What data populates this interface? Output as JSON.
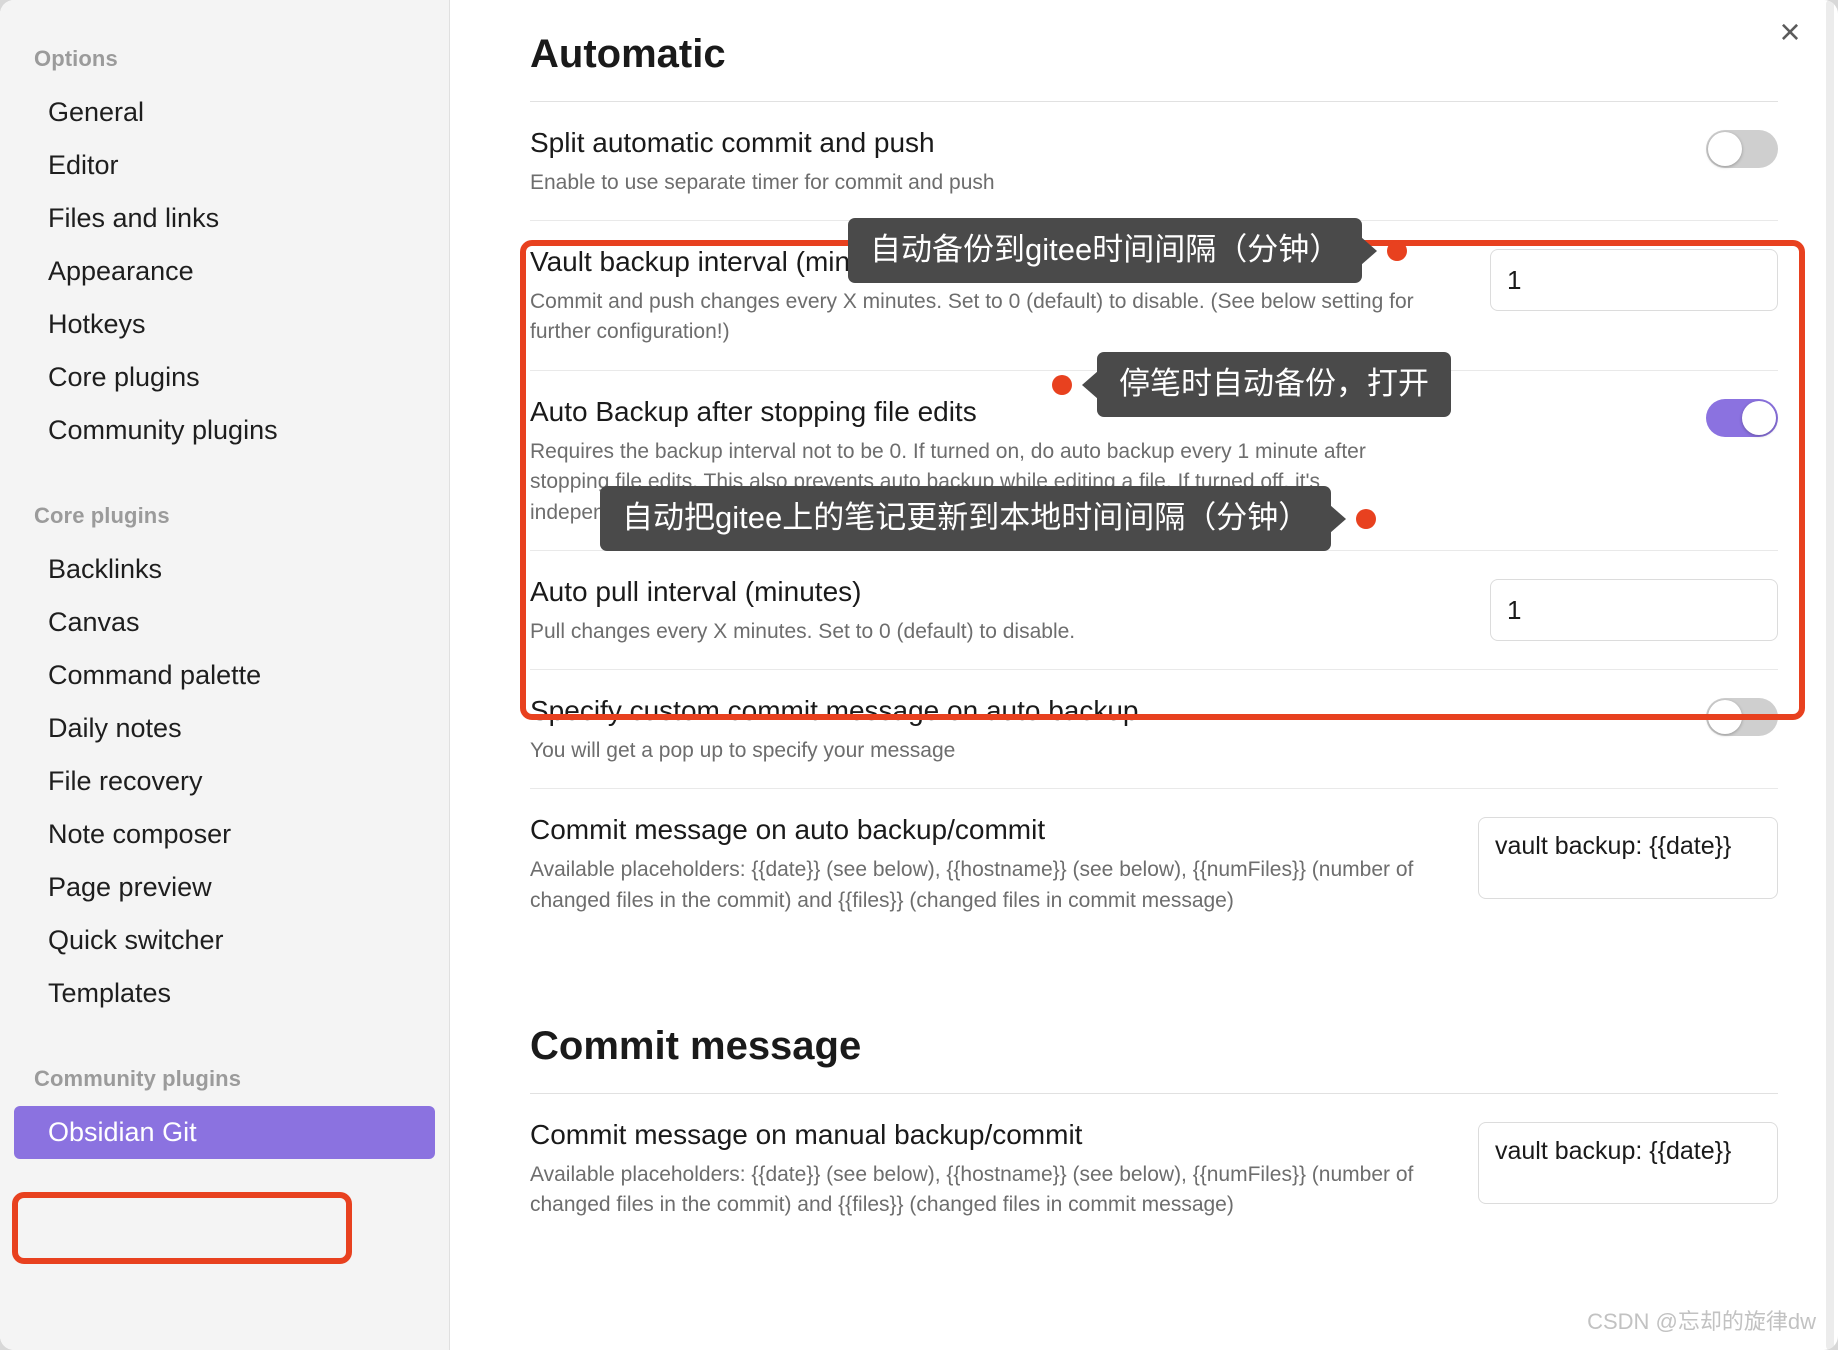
{
  "window": {
    "close_icon": "×",
    "watermark": "CSDN @忘却的旋律dw"
  },
  "sidebar": {
    "groups": [
      {
        "heading": "Options",
        "items": [
          {
            "label": "General"
          },
          {
            "label": "Editor"
          },
          {
            "label": "Files and links"
          },
          {
            "label": "Appearance"
          },
          {
            "label": "Hotkeys"
          },
          {
            "label": "Core plugins"
          },
          {
            "label": "Community plugins"
          }
        ]
      },
      {
        "heading": "Core plugins",
        "items": [
          {
            "label": "Backlinks"
          },
          {
            "label": "Canvas"
          },
          {
            "label": "Command palette"
          },
          {
            "label": "Daily notes"
          },
          {
            "label": "File recovery"
          },
          {
            "label": "Note composer"
          },
          {
            "label": "Page preview"
          },
          {
            "label": "Quick switcher"
          },
          {
            "label": "Templates"
          }
        ]
      },
      {
        "heading": "Community plugins",
        "items": [
          {
            "label": "Obsidian Git",
            "active": true
          }
        ]
      }
    ]
  },
  "main": {
    "section_automatic_title": "Automatic",
    "section_commit_message_title": "Commit message",
    "settings": {
      "split_auto": {
        "name": "Split automatic commit and push",
        "desc": "Enable to use separate timer for commit and push",
        "toggle_state": "off"
      },
      "vault_backup_interval": {
        "name": "Vault backup interval (minutes)",
        "desc": "Commit and push changes every X minutes. Set to 0 (default) to disable. (See below setting for further configuration!)",
        "value": "1"
      },
      "auto_backup_after_stop": {
        "name": "Auto Backup after stopping file edits",
        "desc": "Requires the backup interval not to be 0. If turned on, do auto backup every 1 minute after stopping file edits. This also prevents auto backup while editing a file. If turned off, it's independent from the last change.",
        "toggle_state": "on"
      },
      "auto_pull_interval": {
        "name": "Auto pull interval (minutes)",
        "desc": "Pull changes every X minutes. Set to 0 (default) to disable.",
        "value": "1"
      },
      "specify_custom_message": {
        "name": "Specify custom commit message on auto backup",
        "desc": "You will get a pop up to specify your message",
        "toggle_state": "off"
      },
      "commit_message_auto": {
        "name": "Commit message on auto backup/commit",
        "desc": "Available placeholders: {{date}} (see below), {{hostname}} (see below), {{numFiles}} (number of changed files in the commit) and {{files}} (changed files in commit message)",
        "value": "vault backup: {{date}}"
      },
      "commit_message_manual": {
        "name": "Commit message on manual backup/commit",
        "desc": "Available placeholders: {{date}} (see below), {{hostname}} (see below), {{numFiles}} (number of changed files in the commit) and {{files}} (changed files in commit message)",
        "value": "vault backup: {{date}}"
      }
    },
    "annotations": [
      {
        "text": "自动备份到gitee时间间隔（分钟）",
        "tail": "right"
      },
      {
        "text": "停笔时自动备份，打开",
        "tail": "left"
      },
      {
        "text": "自动把gitee上的笔记更新到本地时间间隔（分钟）",
        "tail": "right"
      }
    ]
  },
  "colors": {
    "accent_purple": "#8b72e0",
    "annotation_red": "#e8411f",
    "callout_bg": "#4a4a4a",
    "sidebar_bg": "#f4f4f4"
  }
}
